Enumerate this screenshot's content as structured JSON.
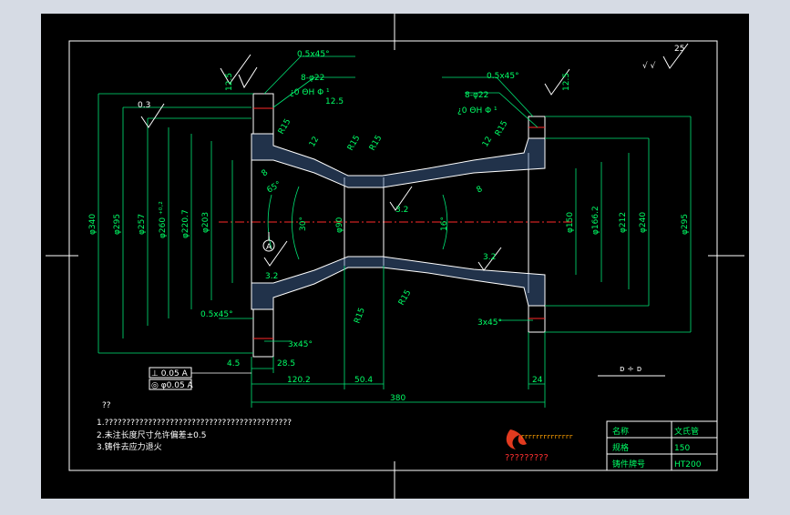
{
  "colors": {
    "frame_bg": "#000000",
    "outer_bg": "#d6dbe4",
    "line": "#ffffff",
    "dimension": "#00ff66",
    "center_line": "#ff2a2a",
    "callout": "#ffff00",
    "section_fill": "#4a6fa5"
  },
  "annotations": {
    "chamfer_top_left": "0.5x45°",
    "holes_top_left": "8-φ22",
    "holes_tol_top_left": "¿0 ΘH Φ ¹",
    "rough_top_left": "12.5",
    "rough_far_left": "12.5",
    "chamfer_top_right": "0.5x45°",
    "holes_top_right": "8-φ22",
    "holes_tol_top_right": "¿0 ΘH Φ ¹",
    "rough_top_right": "12.5",
    "rough_corner": "25",
    "rough_corner_note": "√ √",
    "flat_left": "0.3",
    "r15_a": "R15",
    "r15_b": "R15",
    "r15_c": "R15",
    "r15_d": "R15",
    "r15_e": "R15",
    "r15_f": "R15",
    "len_12a": "12",
    "len_12b": "12",
    "len_8a": "8",
    "len_8b": "8",
    "angle_65": "65°",
    "angle_30": "30°",
    "angle_16": "16°",
    "rough_32_a": "3.2",
    "rough_32_b": "3.2",
    "rough_32_c": "3.2",
    "datum_a": "A",
    "chamfer_bottom_left": "0.5x45°",
    "chamfer_3x45_left": "3x45°",
    "chamfer_3x45_right": "3x45°"
  },
  "dimensions": {
    "d340": "φ340",
    "d295_left": "φ295",
    "d257": "φ257",
    "d260": "φ260 ⁺⁰·²",
    "d220": "φ220.7",
    "d203": "φ203",
    "d90": "φ90",
    "d150": "φ150",
    "d166": "φ166.2",
    "d212": "φ212",
    "d240": "φ240",
    "d295_right": "φ295",
    "w45": "4.5",
    "w285": "28.5",
    "w1202": "120.2",
    "w504": "50.4",
    "w24": "24",
    "w380": "380",
    "tolerance_box": "⊥ 0.05 A",
    "concentric_box": "◎ φ0.05 A"
  },
  "view_symbol": "ᴅ ÷ ᴅ",
  "notes": {
    "heading": "??",
    "line1": "1.???????????????????????????????????????????",
    "line2": "2.未注长度尺寸允许偏差±0.5",
    "line3": "3.铸件去应力退火"
  },
  "logo": {
    "caption_top": "ᴦᴦᴦᴦᴦᴦᴦᴦᴦᴦᴦᴦᴦᴦ",
    "caption_bottom": "?????????"
  },
  "title_block": {
    "name_label": "名称",
    "name_value": "文氏管",
    "spec_label": "规格",
    "spec_value": "150",
    "material_label": "铸件牌号",
    "material_value": "HT200"
  }
}
